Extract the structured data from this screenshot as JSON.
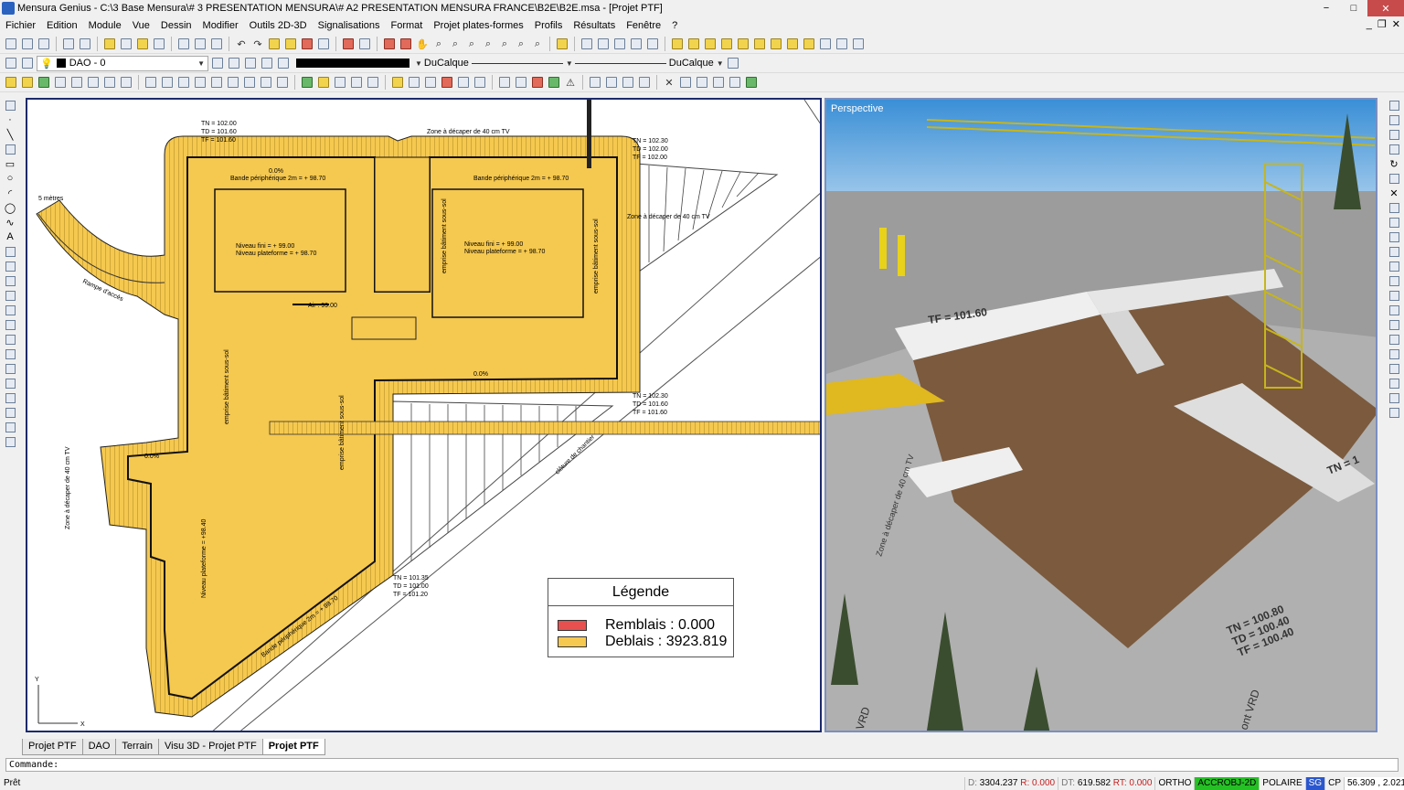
{
  "window": {
    "title": "Mensura Genius - C:\\3 Base Mensura\\# 3 PRESENTATION MENSURA\\# A2 PRESENTATION MENSURA FRANCE\\B2E\\B2E.msa - [Projet PTF]",
    "minimize": "−",
    "maximize": "□",
    "close": "✕"
  },
  "menu": {
    "items": [
      "Fichier",
      "Edition",
      "Module",
      "Vue",
      "Dessin",
      "Modifier",
      "Outils 2D-3D",
      "Signalisations",
      "Format",
      "Projet plates-formes",
      "Profils",
      "Résultats",
      "Fenêtre",
      "?"
    ],
    "doc_controls": [
      "_",
      "❐",
      "✕"
    ]
  },
  "layer_toolbar": {
    "layer": "DAO - 0",
    "linetype_left": "DuCalque",
    "linetype_right": "DuCalque"
  },
  "plan": {
    "labels": {
      "tn1": "TN = 102.00",
      "td1": "TD = 101.60",
      "tf1": "TF = 101.60",
      "zone_top": "Zone à décaper de 40 cm TV",
      "tn2": "TN = 102.30",
      "td2": "TD = 102.00",
      "tf2": "TF = 102.00",
      "zone_right": "Zone à décaper de 40 cm TV",
      "bande_left": "Bande périphérique 2m = + 98.70",
      "bande_right": "Bande périphérique 2m = + 98.70",
      "niveau_fini_l": "Niveau fini = + 99.00",
      "niveau_pf_l": "Niveau plateforme = + 98.70",
      "niveau_fini_r": "Niveau fini = + 99.00",
      "niveau_pf_r": "Niveau plateforme = + 98.70",
      "emprise_v1": "emprise bâtiment sous-sol",
      "emprise_v2": "emprise bâtiment sous-sol",
      "emprise_v3": "emprise bâtiment sous-sol",
      "emprise_v4": "emprise bâtiment sous-sol",
      "air": "Air : 99.00",
      "rampe": "Rampe d'accès",
      "metres": "5 mètres",
      "tn3": "TN = 102.30",
      "td3": "TD = 101.60",
      "tf3": "TF = 101.60",
      "tn4": "TN = 101.35",
      "td4": "TD = 101.00",
      "tf4": "TF = 101.20",
      "cloture": "clôture de chantier",
      "zone_left": "Zone à décaper de 40 cm TV",
      "niveau_pf_vert": "Niveau plateforme = +98.40",
      "bande_diag": "Bande périphérique 2m = + 98.70",
      "pct0": "0.0%",
      "axis_y": "Y",
      "axis_x": "X"
    }
  },
  "legend": {
    "title": "Légende",
    "remblais": "Remblais : 0.000",
    "deblais": "Deblais : 3923.819",
    "remblais_color": "#e85050",
    "deblais_color": "#f5c84f"
  },
  "perspective": {
    "label": "Perspective",
    "tf_label": "TF = 101.60",
    "tn_label": "TN = 100.80",
    "td_label": "TD = 100.40",
    "tf2_label": "TF = 100.40",
    "tn_right": "TN = 1",
    "zone": "Zone à décaper de 40 cm TV",
    "vrd1": "VRD",
    "vrd2": "ont VRD"
  },
  "tabs": [
    "Projet PTF",
    "DAO",
    "Terrain",
    "Visu 3D - Projet PTF",
    "Projet PTF"
  ],
  "active_tab": 4,
  "command": {
    "prompt": "Commande:"
  },
  "status": {
    "ready": "Prêt",
    "d_key": "D:",
    "d_val": "3304.237",
    "r_key": "R:",
    "r_val": "0.000",
    "dt_key": "DT:",
    "dt_val": "619.582",
    "rt_key": "RT:",
    "rt_val": "0.000",
    "ortho": "ORTHO",
    "accrobj": "ACCROBJ-2D",
    "polaire": "POLAIRE",
    "sg": "SG",
    "cp": "CP",
    "coords": "56.309 , 2.021"
  }
}
